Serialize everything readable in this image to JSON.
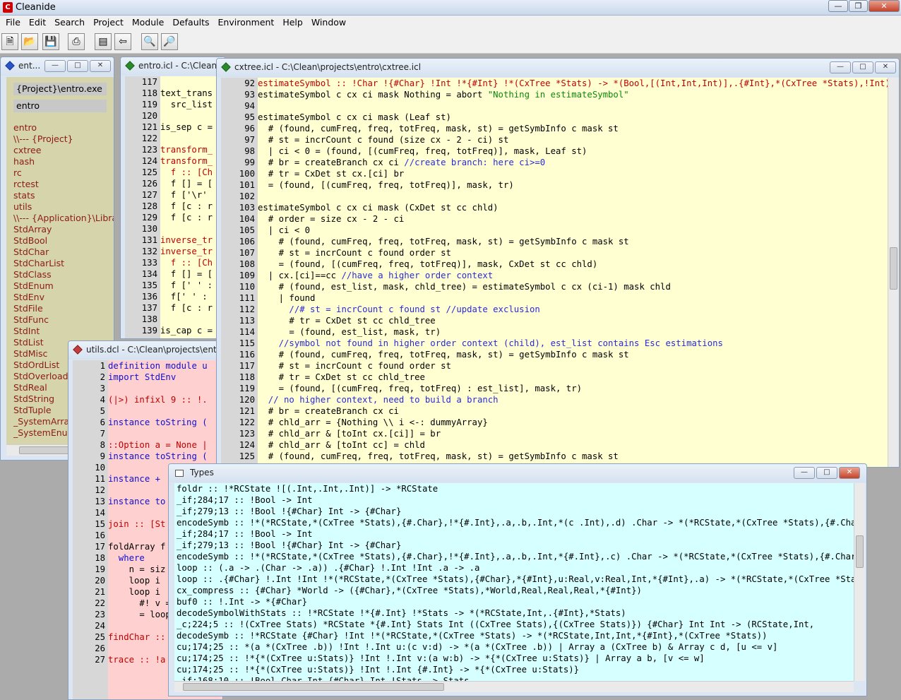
{
  "app": {
    "title": "Cleanide"
  },
  "menu": [
    "File",
    "Edit",
    "Search",
    "Project",
    "Module",
    "Defaults",
    "Environment",
    "Help",
    "Window"
  ],
  "toolbar_icons": [
    "new-file-icon",
    "open-file-icon",
    "save-icon",
    "print-icon",
    "window-icon",
    "back-icon",
    "search-icon",
    "find-icon"
  ],
  "project": {
    "title": "ent...",
    "exe_field": "{Project}\\entro.exe",
    "main_field": "entro",
    "items": [
      "entro",
      "\\\\--- {Project}",
      "cxtree",
      "hash",
      "rc",
      "rctest",
      "stats",
      "utils",
      "\\\\--- {Application}\\Libraries",
      "StdArray",
      "StdBool",
      "StdChar",
      "StdCharList",
      "StdClass",
      "StdEnum",
      "StdEnv",
      "StdFile",
      "StdFunc",
      "StdInt",
      "StdList",
      "StdMisc",
      "StdOrdList",
      "StdOverloaded",
      "StdReal",
      "StdString",
      "StdTuple",
      "_SystemArray",
      "_SystemEnum"
    ]
  },
  "entro": {
    "title": "entro.icl - C:\\Clean\\pro",
    "numbers": [
      "117",
      "118",
      "119",
      "120",
      "121",
      "122",
      "123",
      "124",
      "125",
      "126",
      "127",
      "128",
      "129",
      "130",
      "131",
      "132",
      "133",
      "134",
      "135",
      "136",
      "137",
      "138",
      "139"
    ],
    "lines": [
      "",
      "text_trans",
      "  src_list",
      "",
      "is_sep c =",
      "",
      "transform_",
      "transform_",
      "  f :: [Ch",
      "  f [] = [",
      "  f ['\\r'",
      "  f [c : r",
      "  f [c : r",
      "",
      "inverse_tr",
      "inverse_tr",
      "  f :: [Ch",
      "  f [] = [",
      "  f [' ' :",
      "  f[' ' :",
      "  f [c : r",
      "",
      "is_cap c ="
    ]
  },
  "utils": {
    "title": "utils.dcl - C:\\Clean\\projects\\entro\\",
    "numbers": [
      "1",
      "2",
      "3",
      "4",
      "5",
      "6",
      "7",
      "8",
      "9",
      "10",
      "11",
      "12",
      "13",
      "14",
      "15",
      "16",
      "17",
      "18",
      "19",
      "20",
      "21",
      "22",
      "23",
      "24",
      "25",
      "26",
      "27"
    ],
    "lines": [
      "definition module u",
      "import StdEnv",
      "",
      "(|>) infixl 9 :: !.",
      "",
      "instance toString (",
      "",
      "::Option a = None |",
      "instance toString (",
      "",
      "instance + ",
      "",
      "instance to",
      "",
      "join :: [St",
      "",
      "foldArray f",
      "  where",
      "    n = siz",
      "    loop i",
      "    loop i",
      "      #! v =",
      "      = loop",
      "",
      "findChar ::",
      "",
      "trace :: !a"
    ]
  },
  "cxtree": {
    "title": "cxtree.icl - C:\\Clean\\projects\\entro\\cxtree.icl",
    "numbers": [
      "92",
      "93",
      "94",
      "95",
      "96",
      "97",
      "98",
      "99",
      "100",
      "101",
      "102",
      "103",
      "104",
      "105",
      "106",
      "107",
      "108",
      "109",
      "110",
      "111",
      "112",
      "113",
      "114",
      "115",
      "116",
      "117",
      "118",
      "119",
      "120",
      "121",
      "122",
      "123",
      "124",
      "125"
    ],
    "lines": [
      "estimateSymbol :: !Char !{#Char} !Int !*{#Int} !*(CxTree *Stats) -> *(Bool,[(Int,Int,Int)],.{#Int},*(CxTree *Stats),!Int)",
      "estimateSymbol c cx ci mask Nothing = abort \"Nothing in estimateSymbol\"",
      "",
      "estimateSymbol c cx ci mask (Leaf st)",
      "  # (found, cumFreq, freq, totFreq, mask, st) = getSymbInfo c mask st",
      "  # st = incrCount c found (size cx - 2 - ci) st",
      "  | ci < 0 = (found, [(cumFreq, freq, totFreq)], mask, Leaf st)",
      "  # br = createBranch cx ci //create branch: here ci>=0",
      "  # tr = CxDet st cx.[ci] br",
      "  = (found, [(cumFreq, freq, totFreq)], mask, tr)",
      "",
      "estimateSymbol c cx ci mask (CxDet st cc chld)",
      "  # order = size cx - 2 - ci",
      "  | ci < 0",
      "    # (found, cumFreq, freq, totFreq, mask, st) = getSymbInfo c mask st",
      "    # st = incrCount c found order st",
      "    = (found, [(cumFreq, freq, totFreq)], mask, CxDet st cc chld)",
      "  | cx.[ci]==cc //have a higher order context",
      "    # (found, est_list, mask, chld_tree) = estimateSymbol c cx (ci-1) mask chld",
      "    | found",
      "      //# st = incrCount c found st //update exclusion",
      "      # tr = CxDet st cc chld_tree",
      "      = (found, est_list, mask, tr)",
      "    //symbol not found in higher order context (child), est_list contains Esc estimations",
      "    # (found, cumFreq, freq, totFreq, mask, st) = getSymbInfo c mask st",
      "    # st = incrCount c found order st",
      "    # tr = CxDet st cc chld_tree",
      "    = (found, [(cumFreq, freq, totFreq) : est_list], mask, tr)",
      "  // no higher context, need to build a branch",
      "  # br = createBranch cx ci",
      "  # chld_arr = {Nothing \\\\ i <-: dummyArray}",
      "  # chld_arr & [toInt cx.[ci]] = br",
      "  # chld_arr & [toInt cc] = chld",
      "  # (found, cumFreq, freq, totFreq, mask, st) = getSymbInfo c mask st"
    ]
  },
  "types": {
    "title": "Types",
    "lines": [
      "foldr :: !*RCState ![(.Int,.Int,.Int)] -> *RCState",
      "_if;284;17 :: !Bool -> Int",
      "_if;279;13 :: !Bool !{#Char} Int -> {#Char}",
      "encodeSymb :: !*(*RCState,*(CxTree *Stats),{#.Char},!*{#.Int},.a,.b,.Int,*(c .Int),.d) .Char -> *(*RCState,*(CxTree *Stats),{#.Char},!",
      "_if;284;17 :: !Bool -> Int",
      "_if;279;13 :: !Bool !{#Char} Int -> {#Char}",
      "encodeSymb :: !*(*RCState,*(CxTree *Stats),{#.Char},!*{#.Int},.a,.b,.Int,*{#.Int},.c) .Char -> *(*RCState,*(CxTree *Stats),{#.Char},!",
      "loop :: (.a -> .(Char -> .a)) .{#Char} !.Int !Int .a -> .a",
      "loop :: .{#Char} !.Int !Int !*(*RCState,*(CxTree *Stats),{#Char},*{#Int},u:Real,v:Real,Int,*{#Int},.a) -> *(*RCState,*(CxTree *Stats)",
      "cx_compress :: {#Char} *World -> ({#Char},*(CxTree *Stats),*World,Real,Real,Real,*{#Int})",
      "buf0 :: !.Int -> *{#Char}",
      "decodeSymbolWithStats :: !*RCState !*{#.Int} !*Stats -> *(*RCState,Int,.{#Int},*Stats)",
      "_c;224;5 :: !(CxTree Stats) *RCState *{#.Int} Stats Int ((CxTree Stats),{(CxTree Stats)}) {#Char} Int Int -> (RCState,Int,",
      "decodeSymb :: !*RCState {#Char} !Int !*(*RCState,*(CxTree *Stats) -> *(*RCState,Int,Int,*{#Int},*(CxTree *Stats))",
      "cu;174;25 :: *(a *(CxTree .b)) !Int !.Int u:(c v:d) -> *(a *(CxTree .b)) | Array a (CxTree b) & Array c d, [u <= v]",
      "cu;174;25 :: !*{*(CxTree u:Stats)} !Int !.Int v:(a w:b) -> *{*(CxTree u:Stats)} | Array a b, [v <= w]",
      "cu;174;25 :: !*{*(CxTree u:Stats)} !Int !.Int {#.Int} -> *{*(CxTree u:Stats)}",
      "_if;168;10 :: !Bool Char Int {#Char} Int !Stats -> Stats"
    ]
  },
  "colors": {
    "editor_bg": "#ffffd2",
    "utils_bg": "#ffd0d0",
    "project_bg": "#d6d4aa",
    "types_bg": "#d6ffff",
    "keyword": "#1010d0",
    "error_red": "#c00000",
    "comment": "#2a2ad8",
    "string": "#0a8a0a"
  }
}
